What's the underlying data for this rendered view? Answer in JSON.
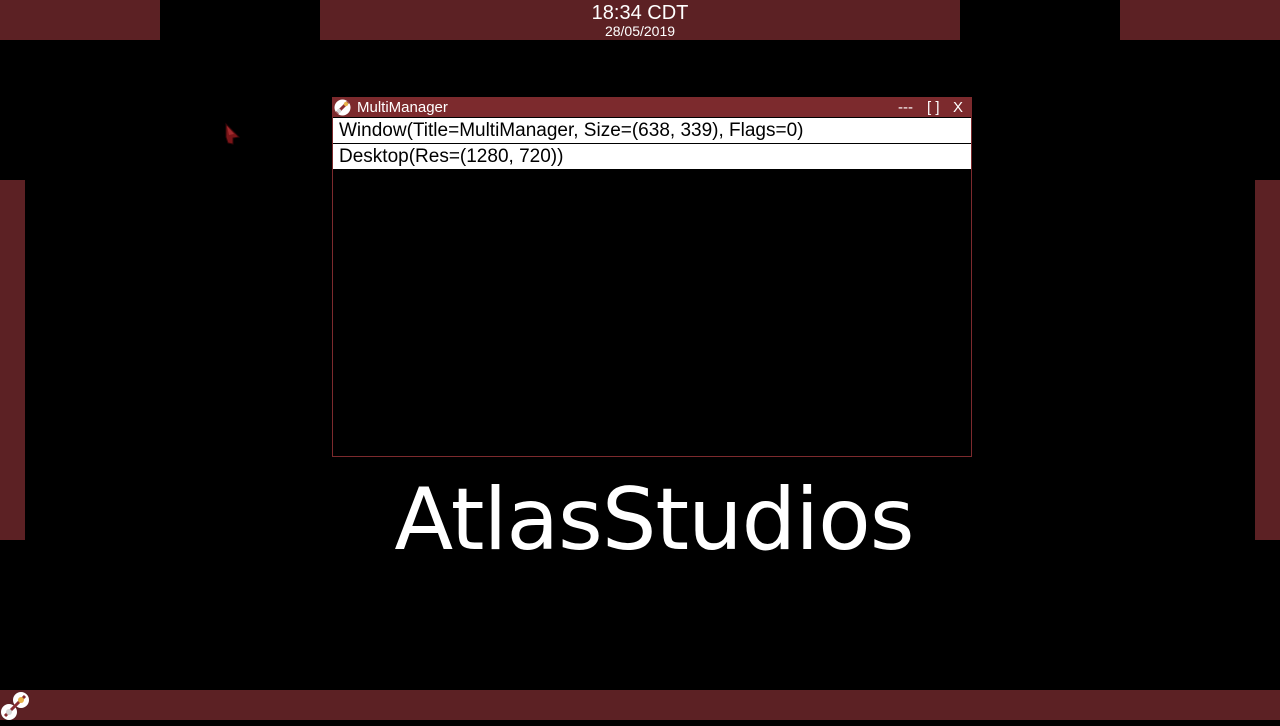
{
  "clock": {
    "time": "18:34 CDT",
    "date": "28/05/2019"
  },
  "window": {
    "title": "MultiManager",
    "minimize_label": "---",
    "maximize_label": "[ ]",
    "close_label": "X",
    "items": [
      {
        "label": "Window(Title=MultiManager, Size=(638, 339), Flags=0)"
      },
      {
        "label": "Desktop(Res=(1280, 720))"
      }
    ]
  },
  "brand": {
    "text": "AtlasStudios"
  },
  "icons": {
    "start": "start-logo-icon",
    "window": "app-logo-icon",
    "cursor": "mouse-cursor-icon"
  },
  "colors": {
    "bar": "#5c2124",
    "titlebar": "#7c2a2d",
    "background": "#000000",
    "row": "#ffffff"
  }
}
